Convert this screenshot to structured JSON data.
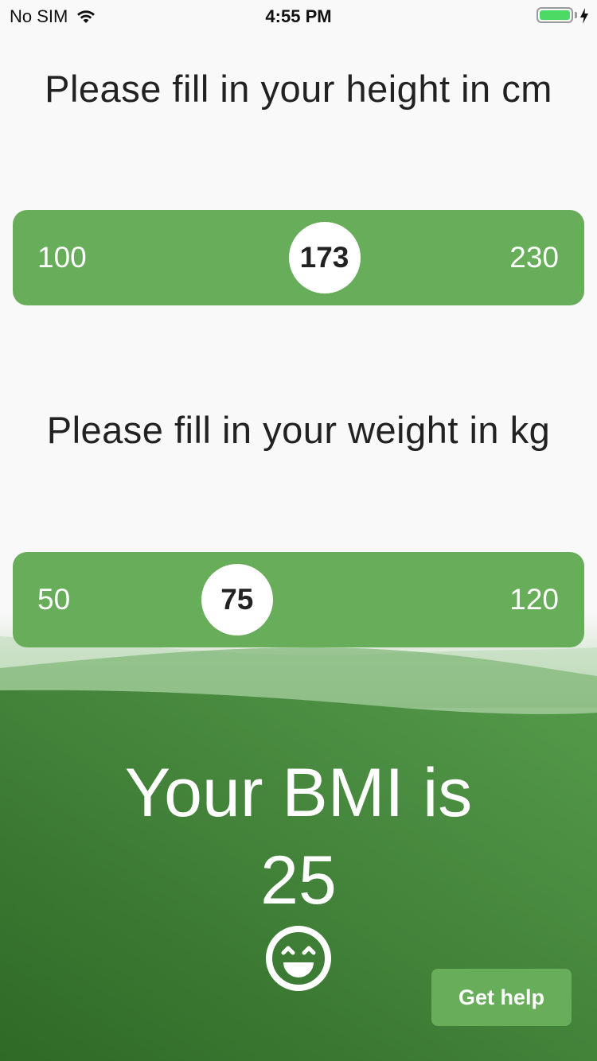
{
  "status_bar": {
    "carrier": "No SIM",
    "time": "4:55 PM",
    "wifi_icon": "wifi-icon",
    "battery_icon": "battery-icon",
    "charging_icon": "bolt-icon"
  },
  "height": {
    "prompt": "Please fill in your height in cm",
    "min_label": "100",
    "max_label": "230",
    "min": 100,
    "max": 230,
    "value": 173,
    "value_label": "173"
  },
  "weight": {
    "prompt": "Please fill in your weight in kg",
    "min_label": "50",
    "max_label": "120",
    "min": 50,
    "max": 120,
    "value": 75,
    "value_label": "75"
  },
  "result": {
    "label": "Your BMI is",
    "value": "25",
    "mood_icon": "smile-icon",
    "help_button": "Get help"
  },
  "colors": {
    "accent": "#68ad5a",
    "dark_green": "#3b7a33",
    "background": "#f9f9f9"
  }
}
